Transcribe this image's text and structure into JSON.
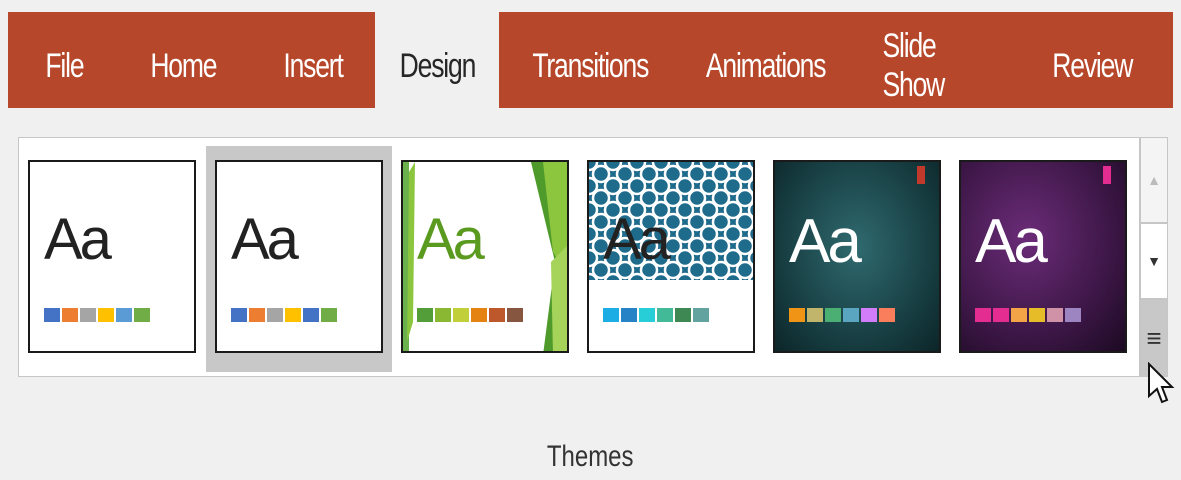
{
  "tabs": [
    {
      "label": "File",
      "active": false
    },
    {
      "label": "Home",
      "active": false
    },
    {
      "label": "Insert",
      "active": false
    },
    {
      "label": "Design",
      "active": true
    },
    {
      "label": "Transitions",
      "active": false
    },
    {
      "label": "Animations",
      "active": false
    },
    {
      "label": "Slide Show",
      "active": false
    },
    {
      "label": "Review",
      "active": false
    }
  ],
  "themes": [
    {
      "sample": "Aa",
      "selected": false,
      "swatches": [
        "#4472c4",
        "#ed7d31",
        "#a5a5a5",
        "#ffc000",
        "#5b9bd5",
        "#70ad47"
      ]
    },
    {
      "sample": "Aa",
      "selected": true,
      "swatches": [
        "#4472c4",
        "#ed7d31",
        "#a5a5a5",
        "#ffc000",
        "#4472c4",
        "#70ad47"
      ]
    },
    {
      "sample": "Aa",
      "selected": false,
      "swatches": [
        "#549e39",
        "#8ab833",
        "#c0cf3a",
        "#e48312",
        "#bd582c",
        "#865640"
      ]
    },
    {
      "sample": "Aa",
      "selected": false,
      "swatches": [
        "#1cade4",
        "#2683c6",
        "#27ced7",
        "#42ba97",
        "#3e8853",
        "#62a39f"
      ]
    },
    {
      "sample": "Aa",
      "selected": false,
      "swatches": [
        "#f09415",
        "#c1b56b",
        "#4baf73",
        "#5aa6c0",
        "#d17df9",
        "#fa7e5c"
      ]
    },
    {
      "sample": "Aa",
      "selected": false,
      "swatches": [
        "#e32d91",
        "#e32d91",
        "#f3a447",
        "#e7bc29",
        "#d092a7",
        "#9c85c0"
      ]
    }
  ],
  "scroll": {
    "up_icon": "▲",
    "down_icon": "▼",
    "more_icon": "≡"
  },
  "group_label": "Themes",
  "colors": {
    "tab_bar": "#b7472a",
    "ribbon_bg": "#f0f0f0"
  }
}
